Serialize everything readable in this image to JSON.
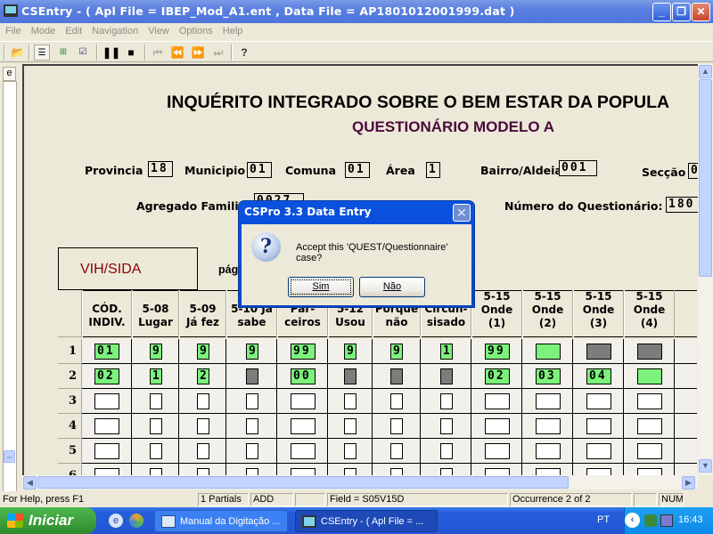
{
  "window": {
    "title": "CSEntry - ( Apl File = IBEP_Mod_A1.ent , Data File = AP1801012001999.dat )",
    "minimize": "_",
    "restore": "❐",
    "close": "✕"
  },
  "menu": [
    "File",
    "Mode",
    "Edit",
    "Navigation",
    "View",
    "Options",
    "Help"
  ],
  "toolbar": {
    "icons": [
      "open-icon",
      "add-case-icon",
      "insert-icon",
      "verify-icon",
      "pause-icon",
      "stop-icon",
      "first-icon",
      "previous-icon",
      "next-icon",
      "last-icon",
      "help-icon"
    ]
  },
  "left_panel": {
    "tab_label": "e"
  },
  "form": {
    "title": "INQUÉRITO INTEGRADO SOBRE O BEM ESTAR DA POPULA",
    "subtitle": "QUESTIONÁRIO MODELO A",
    "fields": {
      "provincia": {
        "label": "Provincia",
        "value": "18"
      },
      "municipio": {
        "label": "Municipio",
        "value": "01"
      },
      "comuna": {
        "label": "Comuna",
        "value": "01"
      },
      "area": {
        "label": "Área",
        "value": "1"
      },
      "bairro": {
        "label": "Bairro/Aldeia",
        "value": "001"
      },
      "seccao": {
        "label": "Secção",
        "value": "0"
      },
      "agregado": {
        "label": "Agregado Familia",
        "value": "0027"
      },
      "numero": {
        "label": "Número do Questionário:",
        "value": "180"
      }
    },
    "section": "VIH/SIDA",
    "page_label": "pág",
    "columns": [
      {
        "line1": "CÓD.",
        "line2": "INDIV."
      },
      {
        "line1": "5-08",
        "line2": "Lugar"
      },
      {
        "line1": "5-09",
        "line2": "Já fez"
      },
      {
        "line1": "5-10 Ja",
        "line2": "sabe"
      },
      {
        "line1": "Par-",
        "line2": "ceiros"
      },
      {
        "line1": "5-12",
        "line2": "Usou"
      },
      {
        "line1": "Porque",
        "line2": "não"
      },
      {
        "line1": "Circun-",
        "line2": "sisado"
      },
      {
        "line1": "5-15",
        "line2": "Onde",
        "line3": "(1)"
      },
      {
        "line1": "5-15",
        "line2": "Onde",
        "line3": "(2)"
      },
      {
        "line1": "5-15",
        "line2": "Onde",
        "line3": "(3)"
      },
      {
        "line1": "5-15",
        "line2": "Onde",
        "line3": "(4)"
      }
    ],
    "rows": [
      {
        "num": "1",
        "cells": [
          [
            "01",
            "green"
          ],
          [
            "9",
            "green"
          ],
          [
            "9",
            "green"
          ],
          [
            "9",
            "green"
          ],
          [
            "99",
            "green"
          ],
          [
            "9",
            "green"
          ],
          [
            "9",
            "green"
          ],
          [
            "1",
            "green"
          ],
          [
            "99",
            "green"
          ],
          [
            "",
            "green"
          ],
          [
            "",
            "gray"
          ],
          [
            "",
            "gray"
          ]
        ]
      },
      {
        "num": "2",
        "cells": [
          [
            "02",
            "green"
          ],
          [
            "1",
            "green"
          ],
          [
            "2",
            "green"
          ],
          [
            "",
            "gray"
          ],
          [
            "00",
            "green"
          ],
          [
            "",
            "gray"
          ],
          [
            "",
            "gray"
          ],
          [
            "",
            "gray"
          ],
          [
            "02",
            "green"
          ],
          [
            "03",
            "green"
          ],
          [
            "04",
            "green"
          ],
          [
            "",
            "green"
          ]
        ]
      },
      {
        "num": "3",
        "cells": [
          [
            "",
            "white"
          ],
          [
            "",
            "white"
          ],
          [
            "",
            "white"
          ],
          [
            "",
            "white"
          ],
          [
            "",
            "white"
          ],
          [
            "",
            "white"
          ],
          [
            "",
            "white"
          ],
          [
            "",
            "white"
          ],
          [
            "",
            "white"
          ],
          [
            "",
            "white"
          ],
          [
            "",
            "white"
          ],
          [
            "",
            "white"
          ]
        ]
      },
      {
        "num": "4",
        "cells": [
          [
            "",
            "white"
          ],
          [
            "",
            "white"
          ],
          [
            "",
            "white"
          ],
          [
            "",
            "white"
          ],
          [
            "",
            "white"
          ],
          [
            "",
            "white"
          ],
          [
            "",
            "white"
          ],
          [
            "",
            "white"
          ],
          [
            "",
            "white"
          ],
          [
            "",
            "white"
          ],
          [
            "",
            "white"
          ],
          [
            "",
            "white"
          ]
        ]
      },
      {
        "num": "5",
        "cells": [
          [
            "",
            "white"
          ],
          [
            "",
            "white"
          ],
          [
            "",
            "white"
          ],
          [
            "",
            "white"
          ],
          [
            "",
            "white"
          ],
          [
            "",
            "white"
          ],
          [
            "",
            "white"
          ],
          [
            "",
            "white"
          ],
          [
            "",
            "white"
          ],
          [
            "",
            "white"
          ],
          [
            "",
            "white"
          ],
          [
            "",
            "white"
          ]
        ]
      },
      {
        "num": "6",
        "cells": [
          [
            "",
            "white"
          ],
          [
            "",
            "white"
          ],
          [
            "",
            "white"
          ],
          [
            "",
            "white"
          ],
          [
            "",
            "white"
          ],
          [
            "",
            "white"
          ],
          [
            "",
            "white"
          ],
          [
            "",
            "white"
          ],
          [
            "",
            "white"
          ],
          [
            "",
            "white"
          ],
          [
            "",
            "white"
          ],
          [
            "",
            "white"
          ]
        ]
      }
    ]
  },
  "dialog": {
    "title": "CSPro 3.3 Data Entry",
    "message": "Accept this 'QUEST/Questionnaire' case?",
    "yes_label": "Sim",
    "no_label": "Não"
  },
  "status": {
    "help": "For Help, press F1",
    "partials": "1 Partials",
    "mode": "ADD",
    "blank": "",
    "field": "Field = S05V15D",
    "occurrence": "Occurrence 2 of 2",
    "blank2": "",
    "num": "NUM"
  },
  "taskbar": {
    "start": "Iniciar",
    "tasks": [
      "Manual da Digitação ...",
      "CSEntry - ( Apl File = ..."
    ],
    "lang": "PT",
    "time": "16:43"
  },
  "colors": {
    "filled": "#7cf27c",
    "skipped": "#7c7c7c",
    "section_text": "#8b0000",
    "subtitle": "#4b0a3c"
  }
}
